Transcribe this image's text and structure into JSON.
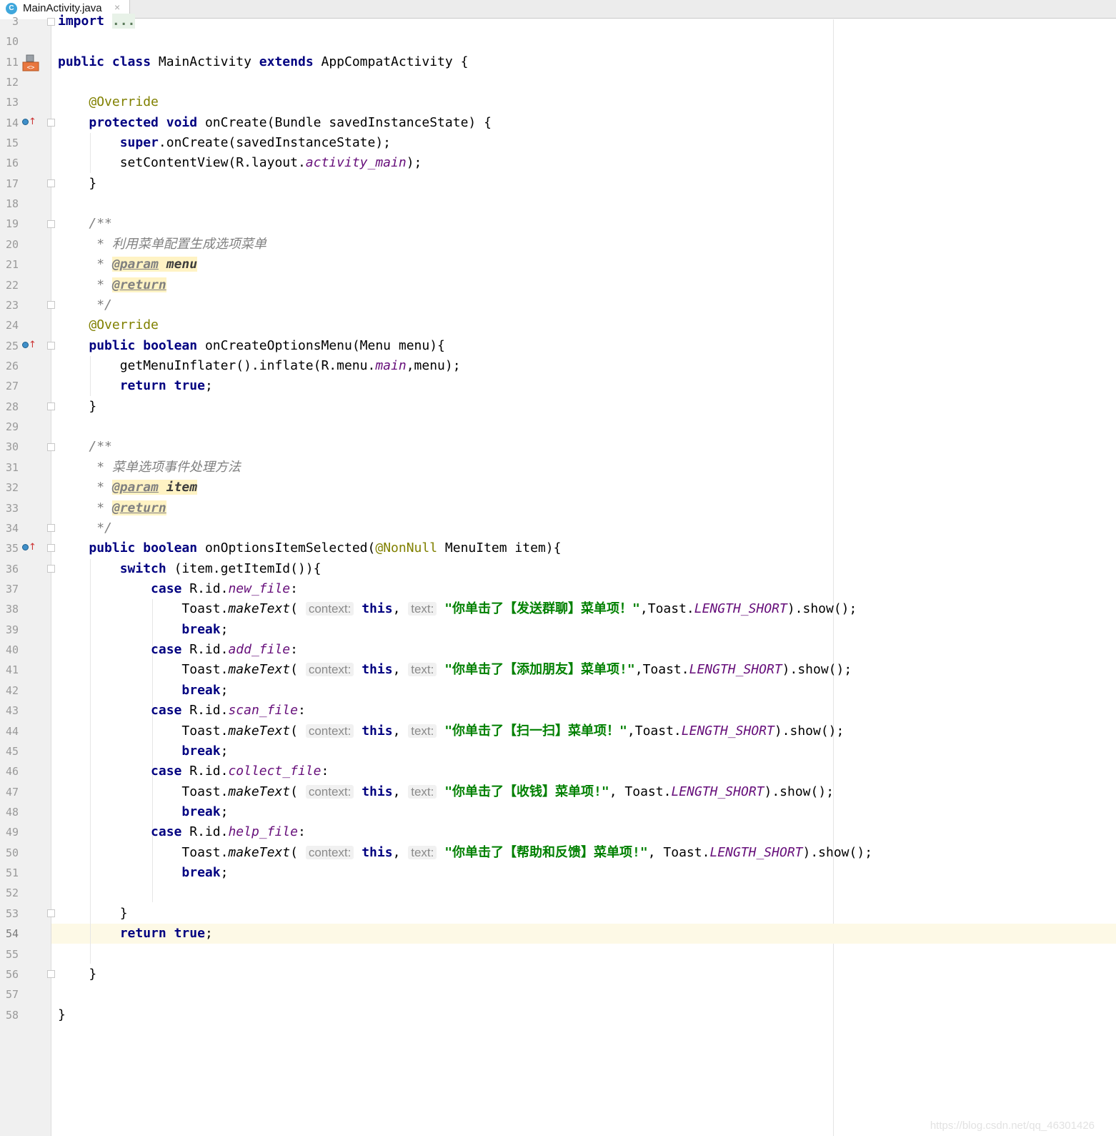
{
  "editor": {
    "tab": {
      "filename": "MainActivity.java",
      "file_type_letter": "C",
      "close_glyph": "×"
    },
    "line_numbers": [
      "3",
      "10",
      "11",
      "12",
      "13",
      "14",
      "15",
      "16",
      "17",
      "18",
      "19",
      "20",
      "21",
      "22",
      "23",
      "24",
      "25",
      "26",
      "27",
      "28",
      "29",
      "30",
      "31",
      "32",
      "33",
      "34",
      "35",
      "36",
      "37",
      "38",
      "39",
      "40",
      "41",
      "42",
      "43",
      "44",
      "45",
      "46",
      "47",
      "48",
      "49",
      "50",
      "51",
      "52",
      "53",
      "54",
      "55",
      "56",
      "57",
      "58"
    ],
    "current_line": "54",
    "code": {
      "import_kw": "import",
      "import_fold": "...",
      "class_line": {
        "kw1": "public",
        "kw2": "class",
        "name": "MainActivity",
        "kw3": "extends",
        "parent": "AppCompatActivity {"
      },
      "override": "@Override",
      "oncreate": {
        "kw1": "protected",
        "kw2": "void",
        "sig": "onCreate(Bundle savedInstanceState) {"
      },
      "super_line": {
        "kw": "super",
        "rest": ".onCreate(savedInstanceState);"
      },
      "set_content": {
        "pre": "setContentView(R.layout.",
        "field": "activity_main",
        "post": ");"
      },
      "close_brace": "}",
      "doc_open": "/**",
      "doc_close": "*/",
      "doc_star": "*",
      "doc1_text": "利用菜单配置生成选项菜单",
      "param_tag": "@param",
      "return_tag": "@return",
      "doc1_param": "menu",
      "ocom": {
        "kw1": "public",
        "kw2": "boolean",
        "sig": "onCreateOptionsMenu(Menu menu){"
      },
      "inflate": {
        "pre": "getMenuInflater().inflate(R.menu.",
        "field": "main",
        "post": ",menu);"
      },
      "return_kw": "return",
      "true_kw": "true",
      "semicolon": ";",
      "doc2_text": "菜单选项事件处理方法",
      "doc2_param": "item",
      "ois": {
        "kw1": "public",
        "kw2": "boolean",
        "name": "onOptionsItemSelected(",
        "ann": "@NonNull",
        "rest": " MenuItem item){"
      },
      "switch_line": {
        "kw": "switch",
        "rest": " (item.getItemId()){"
      },
      "case_kw": "case",
      "rid": "R.id.",
      "colon": ":",
      "break_kw": "break",
      "toast_pre": "Toast.",
      "make_text": "makeText",
      "paren_open": "(",
      "hint_context": "context:",
      "this_kw": "this",
      "comma": ",",
      "hint_text": "text:",
      "toast_class": "Toast.",
      "length_short": "LENGTH_SHORT",
      "show": ").show();",
      "cases": [
        {
          "id": "new_file",
          "msg": "\"你单击了【发送群聊】菜单项！\"",
          "sep": ","
        },
        {
          "id": "add_file",
          "msg": "\"你单击了【添加朋友】菜单项!\"",
          "sep": ","
        },
        {
          "id": "scan_file",
          "msg": "\"你单击了【扫一扫】菜单项！\"",
          "sep": ","
        },
        {
          "id": "collect_file",
          "msg": "\"你单击了【收钱】菜单项!\"",
          "sep": ", "
        },
        {
          "id": "help_file",
          "msg": "\"你单击了【帮助和反馈】菜单项!\"",
          "sep": ", "
        }
      ]
    },
    "watermark": "https://blog.csdn.net/qq_46301426"
  }
}
